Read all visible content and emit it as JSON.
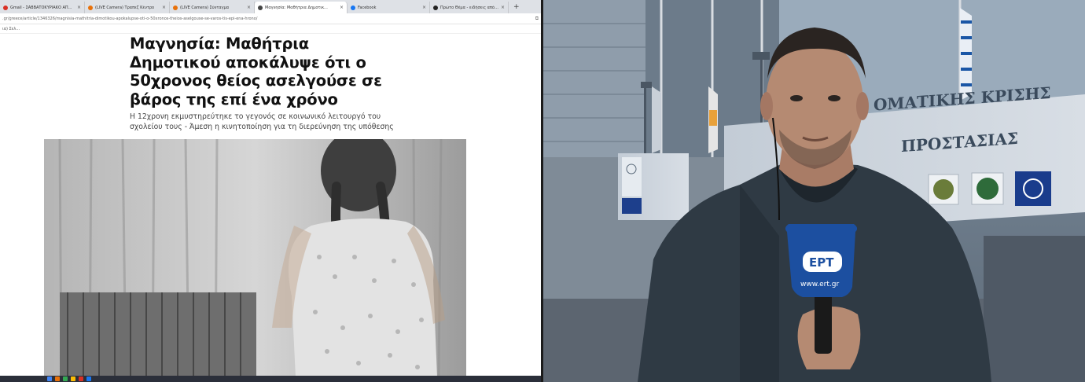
{
  "browser": {
    "tabs": [
      {
        "label": "Gmail - ΣΑΒΒΑΤΟΚΥΡΙΑΚΟ ΑΠ...",
        "icon": "gmail-icon",
        "color": "#d93025",
        "active": false
      },
      {
        "label": "(LIVE Camera) Τραπεζ Κέντρο",
        "icon": "camera-site-icon",
        "color": "#e8710a",
        "active": false
      },
      {
        "label": "(LIVE Camera) Σύνταγμα",
        "icon": "camera-site-icon",
        "color": "#e8710a",
        "active": false
      },
      {
        "label": "Μαγνησία: Μαθήτρια Δημοτικ...",
        "icon": "news-site-icon",
        "color": "#444444",
        "active": true
      },
      {
        "label": "Facebook",
        "icon": "facebook-icon",
        "color": "#1877f2",
        "active": false
      },
      {
        "label": "Πρώτο Θέμα - ειδήσεις από τη...",
        "icon": "news-site-icon",
        "color": "#222222",
        "active": false
      }
    ],
    "new_tab_label": "+",
    "address_url": ".gr/greece/article/1346326/magnisia-mathitria-dimotikou-apokalupse-oti-o-50xronos-theios-aselgouse-se-varos-tis-epi-ena-hrono/",
    "bookmark_label": "ια) Σελ...",
    "headline": "Μαγνησία: Μαθήτρια Δημοτικού αποκάλυψε ότι ο 50χρονος θείος ασελγούσε σε βάρος της επί ένα χρόνο",
    "subtitle": "Η 12χρονη εκμυστηρεύτηκε το γεγονός σε κοινωνικό λειτουργό του σχολείου τους - Άμεση η κινητοποίηση για τη διερεύνηση της υπόθεσης",
    "photo_description_icon": "article-photo-icon"
  },
  "feed": {
    "building_sign_line1": "ΟΜΑΤΙΚΗΣ ΚΡΙΣΗΣ",
    "building_sign_line2": "ΠΡΟΣΤΑΣΙΑΣ",
    "mic_logo": "ΕΡΤ",
    "mic_url": "www.ert.gr"
  },
  "colors": {
    "tab_bar": "#dee1e6",
    "sky": "#a8b8c8",
    "building": "#c9d2dc",
    "jacket": "#2f3a44",
    "mic_flag": "#1c4fa0"
  }
}
